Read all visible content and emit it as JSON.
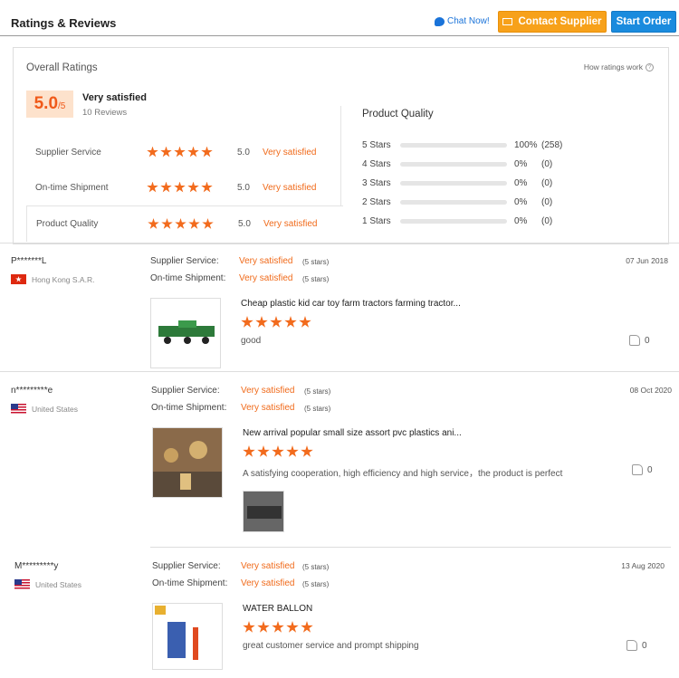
{
  "header": {
    "title": "Ratings & Reviews",
    "chat_label": "Chat Now!",
    "contact_label": "Contact Supplier",
    "start_label": "Start Order"
  },
  "overall": {
    "title": "Overall Ratings",
    "how_label": "How ratings work",
    "score": "5.0",
    "score_denominator": "/5",
    "satisfaction": "Very satisfied",
    "reviews_count": "10 Reviews",
    "metrics": [
      {
        "name": "Supplier Service",
        "stars": 5,
        "value": "5.0",
        "satisfaction": "Very satisfied"
      },
      {
        "name": "On-time Shipment",
        "stars": 5,
        "value": "5.0",
        "satisfaction": "Very satisfied"
      },
      {
        "name": "Product Quality",
        "stars": 5,
        "value": "5.0",
        "satisfaction": "Very satisfied"
      }
    ],
    "product_quality_title": "Product Quality",
    "distribution": [
      {
        "label": "5 Stars",
        "fraction": 1.0,
        "percent": "100%",
        "count": "(258)"
      },
      {
        "label": "4 Stars",
        "fraction": 0.0,
        "percent": "0%",
        "count": "(0)"
      },
      {
        "label": "3 Stars",
        "fraction": 0.0,
        "percent": "0%",
        "count": "(0)"
      },
      {
        "label": "2 Stars",
        "fraction": 0.0,
        "percent": "0%",
        "count": "(0)"
      },
      {
        "label": "1 Stars",
        "fraction": 0.0,
        "percent": "0%",
        "count": "(0)"
      }
    ]
  },
  "reviews": [
    {
      "reviewer": "P*******L",
      "country": "Hong Kong S.A.R.",
      "date": "07 Jun 2018",
      "service_label": "Supplier Service:",
      "service_value": "Very satisfied",
      "service_stars": "(5 stars)",
      "shipment_label": "On-time Shipment:",
      "shipment_value": "Very satisfied",
      "shipment_stars": "(5 stars)",
      "product": "Cheap plastic kid car toy farm tractors farming tractor...",
      "rating": 5,
      "comment": "good",
      "likes": "0"
    },
    {
      "reviewer": "n*********e",
      "country": "United States",
      "date": "08 Oct 2020",
      "service_label": "Supplier Service:",
      "service_value": "Very satisfied",
      "service_stars": "(5 stars)",
      "shipment_label": "On-time Shipment:",
      "shipment_value": "Very satisfied",
      "shipment_stars": "(5 stars)",
      "product": "New arrival popular small size assort pvc plastics ani...",
      "rating": 5,
      "comment": "A satisfying cooperation, high efficiency and high service，the product is perfect",
      "likes": "0"
    },
    {
      "reviewer": "M*********y",
      "country": "United States",
      "date": "13 Aug 2020",
      "service_label": "Supplier Service:",
      "service_value": "Very satisfied",
      "service_stars": "(5 stars)",
      "shipment_label": "On-time Shipment:",
      "shipment_value": "Very satisfied",
      "shipment_stars": "(5 stars)",
      "product": "WATER BALLON",
      "rating": 5,
      "comment": "great customer service and prompt shipping",
      "likes": "0"
    }
  ]
}
